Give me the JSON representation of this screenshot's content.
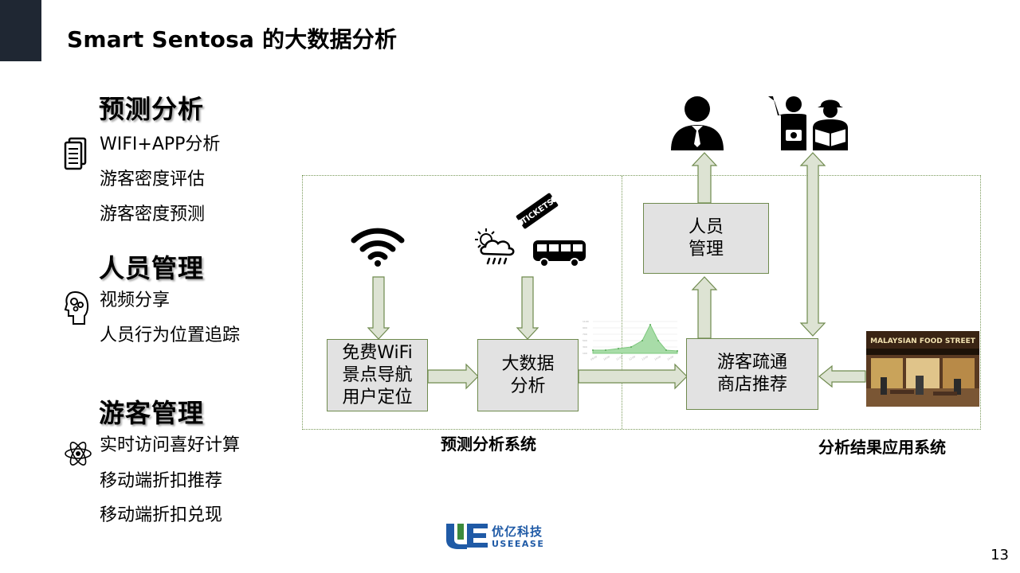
{
  "slide": {
    "title": "Smart Sentosa 的大数据分析",
    "page_number": "13"
  },
  "sections": [
    {
      "heading": "预测分析",
      "icon": "document-icon",
      "items": [
        "WIFI+APP分析",
        "游客密度评估",
        "游客密度预测"
      ]
    },
    {
      "heading": "人员管理",
      "icon": "head-gears-icon",
      "items": [
        "视频分享",
        "人员行为位置追踪"
      ]
    },
    {
      "heading": "游客管理",
      "icon": "atom-icon",
      "items": [
        "实时访问喜好计算",
        "移动端折扣推荐",
        "移动端折扣兑现"
      ]
    }
  ],
  "diagram": {
    "boxes": {
      "wifi_app": "免费WiFi\n景点导航\n用户定位",
      "bigdata": "大数据\n分析",
      "staff": "人员\n管理",
      "visitor": "游客疏通\n商店推荐"
    },
    "labels": {
      "prediction_system": "预测分析系统",
      "application_system": "分析结果应用系统"
    },
    "ticket_text": "TICKETS",
    "photo_sign": "MALAYSIAN FOOD STREET",
    "icons": [
      "wifi-icon",
      "weather-icon",
      "ticket-icon",
      "bus-icon",
      "manager-icon",
      "tourist-icon",
      "food-street-photo"
    ]
  },
  "logo": {
    "name_cn": "优亿科技",
    "name_en": "USEEASE"
  },
  "colors": {
    "dark_block": "#1f2733",
    "box_fill": "#e2e2e2",
    "border_green": "#6f8a4e",
    "arrow_fill": "#dde3d3",
    "brand_blue": "#1f5aa6",
    "chart_green": "#7ec87e"
  }
}
